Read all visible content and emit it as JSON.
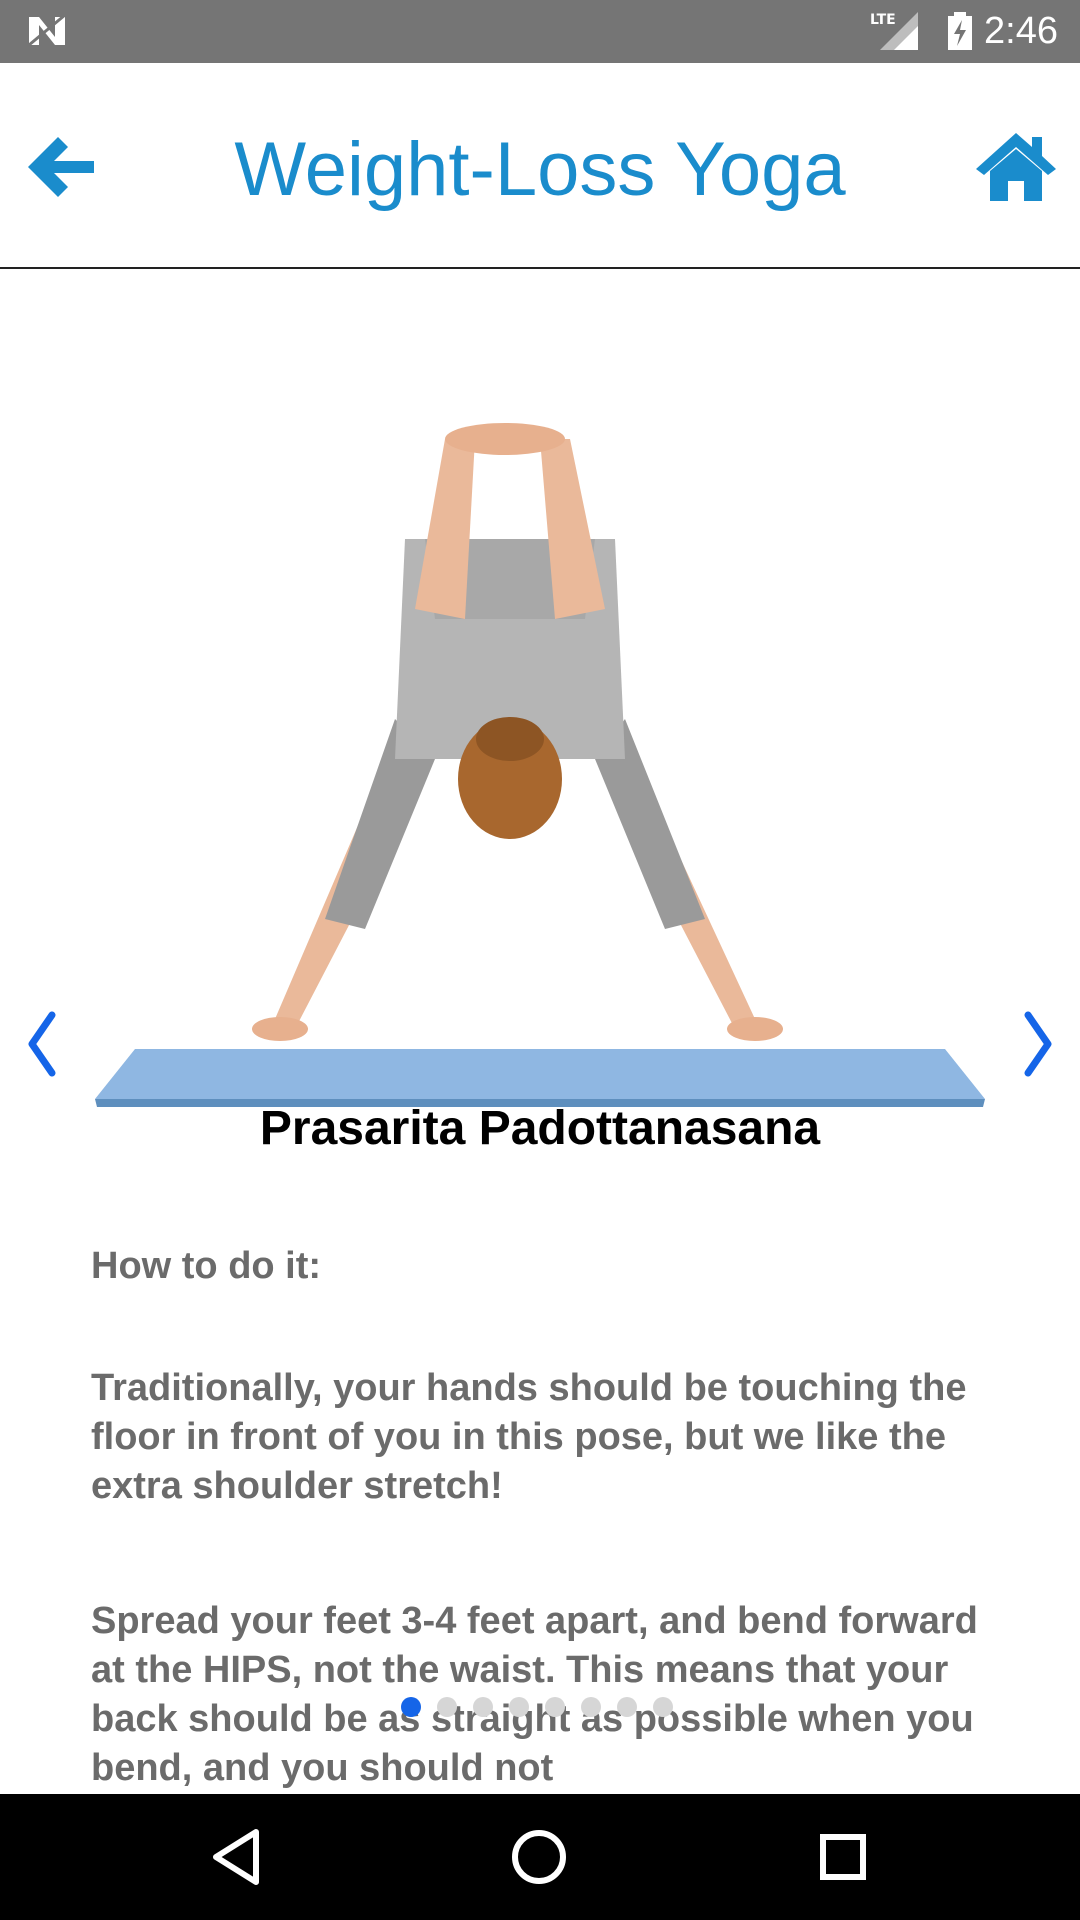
{
  "status_bar": {
    "time": "2:46",
    "network": "LTE",
    "icons": [
      "n-logo-icon",
      "lte-signal-icon",
      "battery-charging-icon"
    ]
  },
  "app_bar": {
    "title": "Weight-Loss Yoga",
    "back_icon": "arrow-left-icon",
    "home_icon": "home-icon",
    "accent_color": "#1a8ccc"
  },
  "pose": {
    "name": "Prasarita Padottanasana",
    "image": "pose-photo",
    "how_to_heading": "How to do it:",
    "paragraphs": [
      "Traditionally, your hands should be touching the floor in front of you in this pose, but we like the extra shoulder stretch!",
      "Spread your feet 3-4 feet apart, and bend forward at the HIPS, not the waist.  This means that your back should be as straight as possible when you bend, and you should not"
    ]
  },
  "carousel": {
    "prev_icon": "chevron-left-icon",
    "next_icon": "chevron-right-icon",
    "page_count": 8,
    "active_index": 0
  },
  "nav_bar": {
    "icons": [
      "nav-back-icon",
      "nav-home-icon",
      "nav-recents-icon"
    ]
  }
}
